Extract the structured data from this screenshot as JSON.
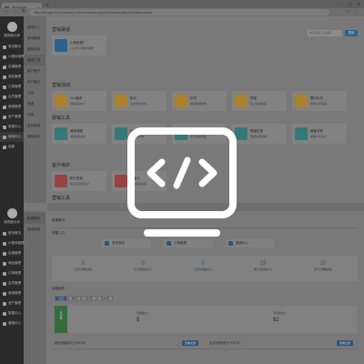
{
  "browser": {
    "tab_label": "营销管理",
    "url": "http://dengxi.f0.jiedanbao.com/anlesiver.jspm/SiteMainBlg/SiteMain.mode"
  },
  "sidebar_top": {
    "user_name": "我的副大师",
    "items": [
      {
        "label": "首页概况",
        "active": false
      },
      {
        "label": "小程序管理",
        "active": false
      },
      {
        "label": "店铺管理",
        "active": false
      },
      {
        "label": "商品管理",
        "active": false
      },
      {
        "label": "订单管理",
        "active": false
      },
      {
        "label": "会员管理",
        "active": false
      },
      {
        "label": "营销管理",
        "active": false
      },
      {
        "label": "资产管理",
        "active": false
      },
      {
        "label": "数据中心",
        "active": false
      },
      {
        "label": "营销中心",
        "active": true
      },
      {
        "label": "设置",
        "active": false
      }
    ]
  },
  "submenu_top": [
    "营销中心",
    "营销渠道",
    "营销活动",
    "营销工具",
    "客户维护",
    "用户触达",
    "互动",
    "拼团",
    "分销",
    "会员营销",
    "营销资料"
  ],
  "main_top": {
    "search_placeholder": "搜索营销工具名称",
    "search_button": "搜索",
    "sections": [
      {
        "title": "营销渠道",
        "cards": [
          {
            "title": "小程序推广",
            "sub": "公众号/小程序码推广",
            "icon": "wechat-icon",
            "color": "#2f6fa8"
          }
        ]
      },
      {
        "title": "营销活动",
        "cards": [
          {
            "title": "DIY营销",
            "sub": "营销活动DIY",
            "icon": "diy-icon",
            "color": "#c9952e"
          },
          {
            "title": "砍价",
            "sub": "好友帮忙砍价",
            "icon": "bargain-icon",
            "color": "#c9952e"
          },
          {
            "title": "秒杀",
            "sub": "限时限量抢购",
            "icon": "flashsale-icon",
            "color": "#c9952e"
          },
          {
            "title": "拼团",
            "sub": "多人拼团购买",
            "icon": "groupbuy-icon",
            "color": "#c9952e"
          },
          {
            "title": "限时折扣",
            "sub": "限时打折促销",
            "icon": "discount-icon",
            "color": "#c9952e"
          }
        ]
      },
      {
        "title": "促销工具",
        "cards": [
          {
            "title": "满减满赠",
            "sub": "满额减钱送礼",
            "icon": "calc-icon",
            "color": "#3a8a8a"
          },
          {
            "title": "优惠券",
            "sub": "发放优惠券",
            "icon": "coupon-icon",
            "color": "#3a8a8a"
          },
          {
            "title": "积分商城",
            "sub": "积分兑换商品",
            "icon": "points-icon",
            "color": "#3a8a8a"
          },
          {
            "title": "限量优惠",
            "sub": "限量优惠促销",
            "icon": "snow-icon",
            "color": "#3a8a8a"
          },
          {
            "title": "新客专享",
            "sub": "新客户专享价",
            "icon": "newuser-icon",
            "color": "#3a8a8a"
          }
        ]
      },
      {
        "title": "客户维护",
        "cards": [
          {
            "title": "积分签到",
            "sub": "每日签到送积分",
            "icon": "checkin-icon",
            "color": "#b14a4a"
          },
          {
            "title": "储值卡",
            "sub": "会员储值充值",
            "icon": "card-icon",
            "color": "#b14a4a"
          }
        ]
      },
      {
        "title": "营销工具",
        "cards": []
      }
    ]
  },
  "sidebar_bottom": {
    "user_name": "我的副大师",
    "items": [
      {
        "label": "首页概况",
        "active": false
      },
      {
        "label": "小程序管理",
        "active": false
      },
      {
        "label": "店铺管理",
        "active": false
      },
      {
        "label": "商品管理",
        "active": false
      },
      {
        "label": "订单管理",
        "active": false
      },
      {
        "label": "会员管理",
        "active": false
      },
      {
        "label": "营销管理",
        "active": false
      },
      {
        "label": "资产管理",
        "active": false
      },
      {
        "label": "数据中心",
        "active": false
      },
      {
        "label": "营销中心",
        "active": false
      }
    ]
  },
  "submenu_bottom": [
    "数据概况",
    "营销数据"
  ],
  "main_bottom": {
    "page_title": "数据概况",
    "quick_title": "快捷入口",
    "quick": [
      "发布商品",
      "订单管理",
      "营销中心"
    ],
    "stats": [
      {
        "value": "0",
        "label": "今日订单数(笔)"
      },
      {
        "value": "0",
        "label": "今日销售额(元)"
      },
      {
        "value": "0",
        "label": "今日访客数(人)"
      },
      {
        "value": "19",
        "label": "累计会员数(人)"
      },
      {
        "value": "20",
        "label": "累计订单数(笔)"
      }
    ],
    "trend_title": "经营趋势",
    "filters": [
      "今日",
      "昨日",
      "近7天",
      "近30天"
    ],
    "trend_side": "访问量",
    "trend_items": [
      {
        "label": "访客数(人)",
        "value": "5"
      },
      {
        "label": "浏览量(次)",
        "value": "82"
      }
    ],
    "bottom_left_title": "商品销量排行(TOP10)",
    "bottom_right_title": "会员消费排行(TOP10)",
    "more_button": "查看全部"
  }
}
